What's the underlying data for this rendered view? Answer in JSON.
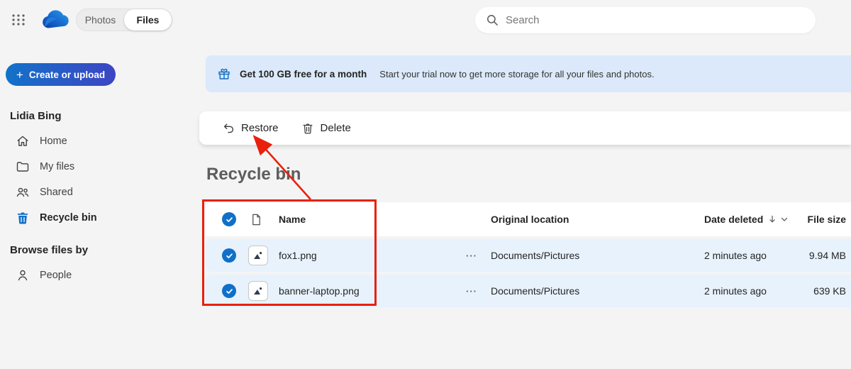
{
  "topbar": {
    "search_placeholder": "Search",
    "toggle": {
      "photos": "Photos",
      "files": "Files",
      "selected": "Files"
    }
  },
  "sidebar": {
    "create_button": "Create or upload",
    "account_name": "Lidia Bing",
    "items": [
      {
        "label": "Home",
        "icon": "home-icon",
        "selected": false
      },
      {
        "label": "My files",
        "icon": "folder-icon",
        "selected": false
      },
      {
        "label": "Shared",
        "icon": "people-icon",
        "selected": false
      },
      {
        "label": "Recycle bin",
        "icon": "trash-filled-icon",
        "selected": true
      }
    ],
    "browse_header": "Browse files by",
    "browse_items": [
      {
        "label": "People",
        "icon": "person-icon"
      }
    ]
  },
  "banner": {
    "title": "Get 100 GB free for a month",
    "subtitle": "Start your trial now to get more storage for all your files and photos.",
    "icon": "gift-icon"
  },
  "toolbar": {
    "restore_label": "Restore",
    "delete_label": "Delete"
  },
  "page": {
    "title": "Recycle bin"
  },
  "table": {
    "headers": {
      "name": "Name",
      "location": "Original location",
      "date": "Date deleted",
      "size": "File size"
    },
    "sort": {
      "column": "Date deleted",
      "direction": "descending"
    },
    "more_glyph": "···",
    "rows": [
      {
        "name": "fox1.png",
        "type": "image",
        "location": "Documents/Pictures",
        "date": "2 minutes ago",
        "size": "9.94 MB",
        "selected": true
      },
      {
        "name": "banner-laptop.png",
        "type": "image",
        "location": "Documents/Pictures",
        "date": "2 minutes ago",
        "size": "639 KB",
        "selected": true
      }
    ],
    "select_all_checked": true
  },
  "annotations": {
    "rectangle": "highlights selected rows and name column",
    "arrow": "points from highlighted rows to Restore button",
    "color": "#e8210d"
  },
  "colors": {
    "accent_blue": "#1070c9",
    "button_gradient_start": "#1272c9",
    "button_gradient_end": "#3d45c3",
    "banner_bg": "#dbe9fa",
    "selected_row_bg": "#e8f2fc",
    "page_bg": "#f4f4f4",
    "annotation_red": "#e8210d"
  }
}
